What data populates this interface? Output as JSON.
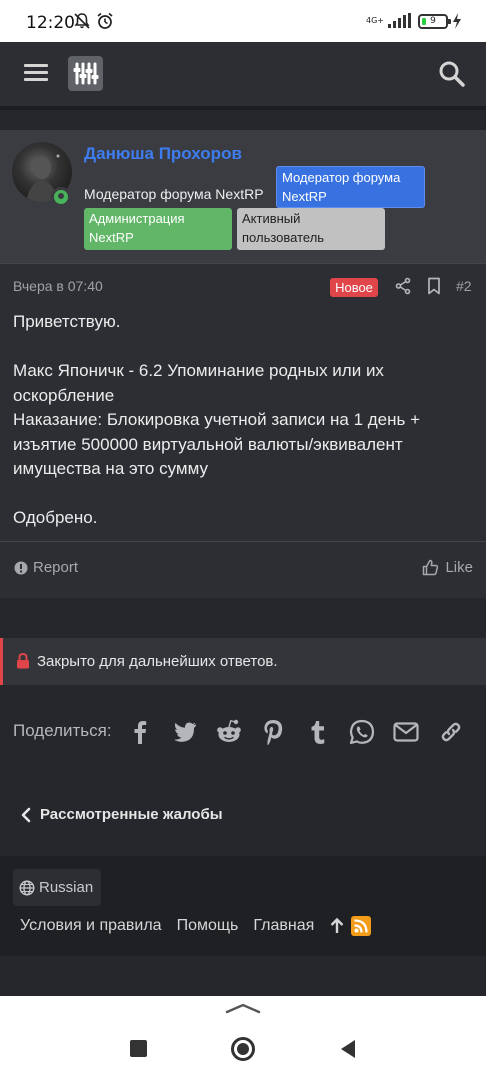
{
  "status_bar": {
    "time": "12:20",
    "network": "4G+",
    "battery": "9"
  },
  "post": {
    "username": "Данюша Прохоров",
    "user_title": "Модератор форума NextRP",
    "badges": {
      "moderator": "Модератор форума NextRP",
      "administration": "Администрация NextRP",
      "active": "Активный пользователь"
    },
    "date": "Вчера в 07:40",
    "new_label": "Новое",
    "number": "#2",
    "body": {
      "greeting": "Приветствую.",
      "line1": "Макс Японичк - 6.2 Упоминание родных или их оскорбление",
      "line2": "Наказание: Блокировка учетной записи на 1 день + изъятие 500000 виртуальной валюты/эквивалент имущества на это сумму",
      "verdict": "Одобрено."
    },
    "report_label": "Report",
    "like_label": "Like"
  },
  "closed_notice": "Закрыто для дальнейших ответов.",
  "share": {
    "label": "Поделиться:",
    "icons": [
      "facebook-icon",
      "twitter-icon",
      "reddit-icon",
      "pinterest-icon",
      "tumblr-icon",
      "whatsapp-icon",
      "email-icon",
      "link-icon"
    ]
  },
  "breadcrumb": "Рассмотренные жалобы",
  "footer": {
    "language": "Russian",
    "links": [
      "Условия и правила",
      "Помощь",
      "Главная"
    ]
  },
  "colors": {
    "accent_blue": "#3d7df0",
    "new_badge": "#e0454a",
    "admin_badge": "#61b667",
    "moderator_badge": "#3872e0",
    "rss": "#f39c19"
  }
}
